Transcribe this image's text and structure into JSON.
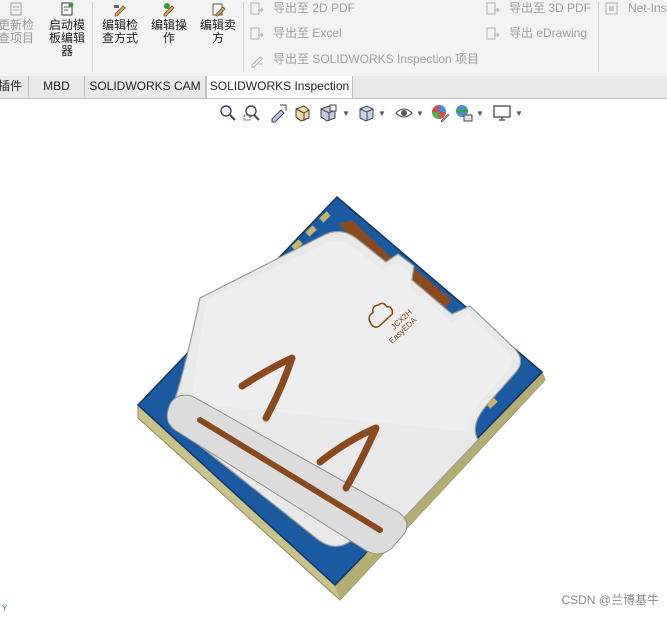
{
  "ribbon": {
    "update_items_label": "更新检查项目",
    "start_template_editor_label": "启动模板编辑器",
    "edit_inspection_method_label": "编辑检查方式",
    "edit_operation_label": "编辑操作",
    "edit_vendor_label": "编辑卖方",
    "export_2d_pdf_label": "导出至 2D PDF",
    "export_excel_label": "导出至 Excel",
    "export_inspection_project_label": "导出至 SOLIDWORKS Inspection 项目",
    "export_3d_pdf_label": "导出至 3D PDF",
    "export_edrawing_label": "导出 eDrawing",
    "net_inspect_label": "Net-Ins"
  },
  "tabs": [
    {
      "label": "插件"
    },
    {
      "label": "MBD"
    },
    {
      "label": "SOLIDWORKS CAM"
    },
    {
      "label": "SOLIDWORKS Inspection"
    }
  ],
  "viewport": {
    "model_label_line1": "JCX2H",
    "model_label_line2": "EasyEDA",
    "triad_label": "Y",
    "watermark": "CSDN @兰博基牛"
  },
  "colors": {
    "pcb_blue": "#1a5aa0",
    "shell_silver": "#e9e9ea",
    "contact_copper": "#8a4a20",
    "base_tan": "#c9c28a"
  },
  "icons": [
    "zoom-to-fit-icon",
    "zoom-to-area-icon",
    "previous-view-icon",
    "section-view-icon",
    "dynamic-annotation-icon",
    "view-orientation-icon",
    "display-style-icon",
    "hide-show-items-icon",
    "edit-appearance-icon",
    "apply-scene-icon",
    "view-settings-icon"
  ]
}
